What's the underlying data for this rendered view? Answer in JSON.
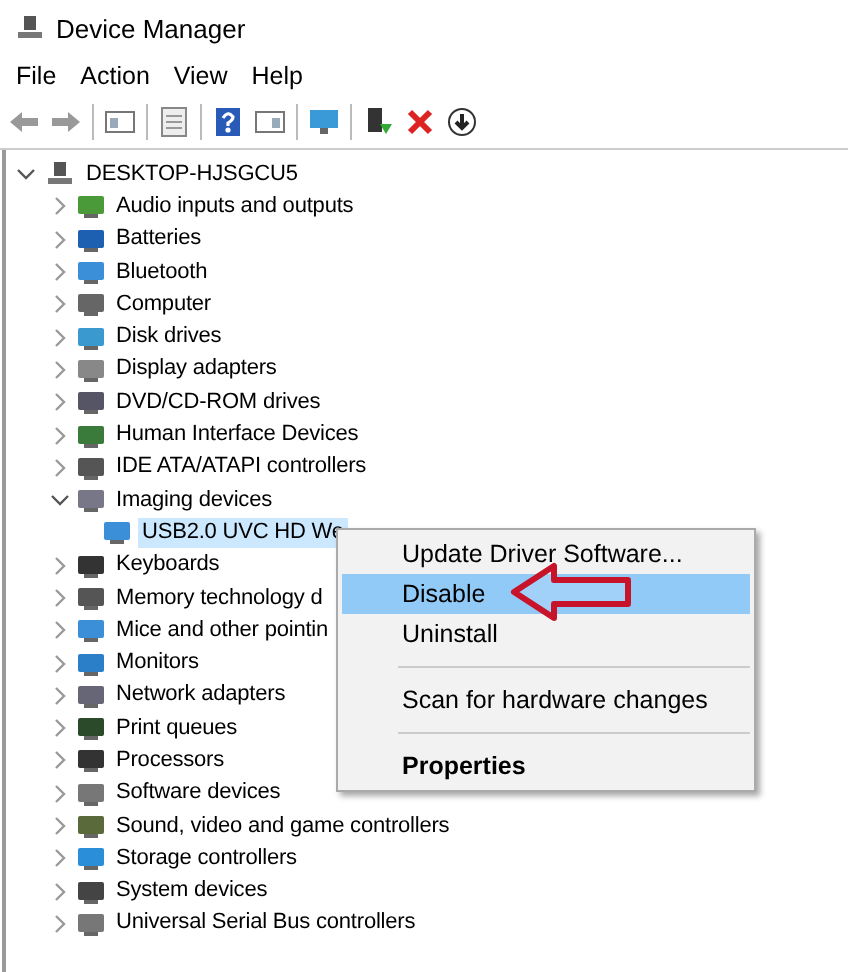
{
  "window": {
    "title": "Device Manager"
  },
  "menu_bar": [
    "File",
    "Action",
    "View",
    "Help"
  ],
  "tree": {
    "label": "DESKTOP-HJSGCU5",
    "expanded": true,
    "selected": false,
    "children": [
      {
        "label": "Audio inputs and outputs",
        "expanded": false,
        "selected": false
      },
      {
        "label": "Batteries",
        "expanded": false,
        "selected": false
      },
      {
        "label": "Bluetooth",
        "expanded": false,
        "selected": false
      },
      {
        "label": "Computer",
        "expanded": false,
        "selected": false
      },
      {
        "label": "Disk drives",
        "expanded": false,
        "selected": false
      },
      {
        "label": "Display adapters",
        "expanded": false,
        "selected": false
      },
      {
        "label": "DVD/CD-ROM drives",
        "expanded": false,
        "selected": false
      },
      {
        "label": "Human Interface Devices",
        "expanded": false,
        "selected": false
      },
      {
        "label": "IDE ATA/ATAPI controllers",
        "expanded": false,
        "selected": false
      },
      {
        "label": "Imaging devices",
        "expanded": true,
        "selected": false,
        "children": [
          {
            "label": "USB2.0 UVC HD We",
            "selected": true
          }
        ]
      },
      {
        "label": "Keyboards",
        "expanded": false,
        "selected": false
      },
      {
        "label": "Memory technology d",
        "expanded": false,
        "selected": false
      },
      {
        "label": "Mice and other pointin",
        "expanded": false,
        "selected": false
      },
      {
        "label": "Monitors",
        "expanded": false,
        "selected": false
      },
      {
        "label": "Network adapters",
        "expanded": false,
        "selected": false
      },
      {
        "label": "Print queues",
        "expanded": false,
        "selected": false
      },
      {
        "label": "Processors",
        "expanded": false,
        "selected": false
      },
      {
        "label": "Software devices",
        "expanded": false,
        "selected": false
      },
      {
        "label": "Sound, video and game controllers",
        "expanded": false,
        "selected": false
      },
      {
        "label": "Storage controllers",
        "expanded": false,
        "selected": false
      },
      {
        "label": "System devices",
        "expanded": false,
        "selected": false
      },
      {
        "label": "Universal Serial Bus controllers",
        "expanded": false,
        "selected": false
      }
    ]
  },
  "context_menu": [
    {
      "kind": "item",
      "label": "Update Driver Software...",
      "selected": false
    },
    {
      "kind": "item",
      "label": "Disable",
      "selected": true
    },
    {
      "kind": "item",
      "label": "Uninstall",
      "selected": false
    },
    {
      "kind": "separator"
    },
    {
      "kind": "item",
      "label": "Scan for hardware changes",
      "selected": false
    },
    {
      "kind": "separator"
    },
    {
      "kind": "default",
      "label": "Properties",
      "selected": false
    }
  ]
}
